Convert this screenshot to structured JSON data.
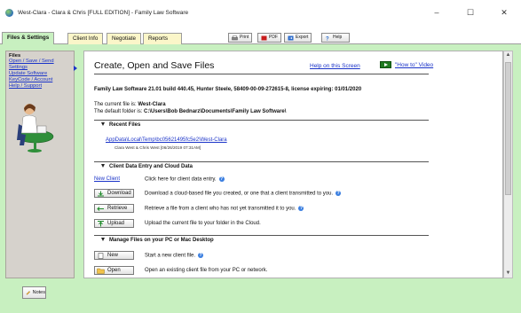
{
  "window": {
    "title": "West-Clara - Clara & Chris [FULL EDITION] - Family Law Software",
    "minimize": "–",
    "maximize": "☐",
    "close": "✕"
  },
  "tabs": [
    {
      "label": "Files & Settings",
      "active": true
    },
    {
      "label": "Client Info",
      "active": false
    },
    {
      "label": "Negotiate",
      "active": false
    },
    {
      "label": "Reports",
      "active": false
    }
  ],
  "toolbar": {
    "print": "Print",
    "pdf": "PDF",
    "export": "Export",
    "help": "Help"
  },
  "sidebar": {
    "header": "Files",
    "items": [
      {
        "label": "Open / Save / Send",
        "selected": true
      },
      {
        "label": "Settings"
      },
      {
        "label": "Update Software"
      },
      {
        "label": "KeyCode / Account"
      },
      {
        "label": "Help / Support"
      }
    ]
  },
  "main": {
    "title": "Create, Open and Save Files",
    "help_link": "Help on this Screen",
    "video_link": "\"How to\" Video",
    "build_info": "Family Law Software  21.01 build 440.45, Hunter Steele, 58409-00-09-272615-8, license expiring: 01/01/2020",
    "current_file_label": "The current file is:",
    "current_file": "West-Clara",
    "default_folder_label": "The default folder is:",
    "default_folder": "C:\\Users\\Bob Bednarz\\Documents\\Family Law Software\\",
    "recent": {
      "heading": "Recent Files",
      "path": "AppData\\Local\\Temp\\bc05621495fc5e2\\West-Clara",
      "sub": "Clara West & Chris West [06/26/2019 07:31AM]"
    },
    "client_section": {
      "heading": "Client Data Entry and Cloud Data",
      "rows": [
        {
          "button": "New Client",
          "desc": "Click here for client data entry.",
          "help": true
        },
        {
          "button": "Download",
          "desc": "Download a cloud-based file you created, or one that a client transmitted to you.",
          "help": true
        },
        {
          "button": "Retrieve",
          "desc": "Retrieve a file from a client who has not yet transmitted it to you.",
          "help": true
        },
        {
          "button": "Upload",
          "desc": "Upload the current file to your folder in the Cloud.",
          "help": false
        }
      ]
    },
    "manage_section": {
      "heading": "Manage Files on your PC or Mac Desktop",
      "rows": [
        {
          "button": "New",
          "desc": "Start a new client file.",
          "help": true
        },
        {
          "button": "Open",
          "desc": "Open an existing client file from your PC or network.",
          "help": false
        }
      ]
    },
    "help_glyph": "?"
  },
  "footer": {
    "notes": "Notes"
  },
  "scrollbar": {
    "up": "▲",
    "down": "▼"
  },
  "colors": {
    "frame_green": "#c8f0c0",
    "tab_yellow": "#fbf6c9",
    "link_blue": "#1a33c8"
  }
}
